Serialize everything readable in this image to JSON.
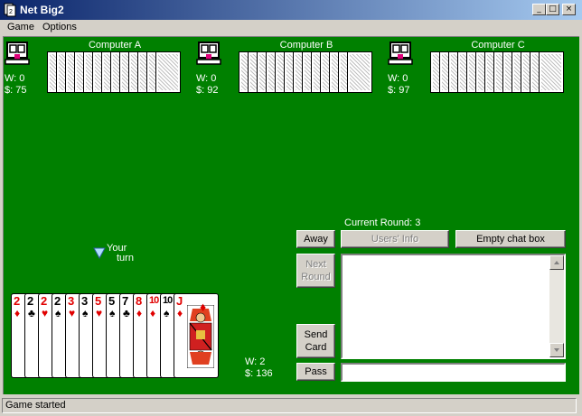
{
  "window": {
    "title": "Net Big2"
  },
  "menu": [
    {
      "label": "Game"
    },
    {
      "label": "Options"
    }
  ],
  "window_buttons": {
    "minimize": "_",
    "maximize": "□",
    "close": "×"
  },
  "opponents": [
    {
      "name": "Computer A",
      "wins": "W: 0",
      "money": "$: 75"
    },
    {
      "name": "Computer B",
      "wins": "W: 0",
      "money": "$: 92"
    },
    {
      "name": "Computer C",
      "wins": "W: 0",
      "money": "$: 97"
    }
  ],
  "turn_indicator": {
    "line1": "Your",
    "line2": "turn"
  },
  "player": {
    "wins": "W: 2",
    "money": "$: 136",
    "cards": [
      {
        "rank": "2",
        "suit": "♦",
        "color": "red"
      },
      {
        "rank": "2",
        "suit": "♣",
        "color": "black"
      },
      {
        "rank": "2",
        "suit": "♥",
        "color": "red"
      },
      {
        "rank": "2",
        "suit": "♠",
        "color": "black"
      },
      {
        "rank": "3",
        "suit": "♥",
        "color": "red"
      },
      {
        "rank": "3",
        "suit": "♠",
        "color": "black"
      },
      {
        "rank": "5",
        "suit": "♥",
        "color": "red"
      },
      {
        "rank": "5",
        "suit": "♠",
        "color": "black"
      },
      {
        "rank": "7",
        "suit": "♣",
        "color": "black"
      },
      {
        "rank": "8",
        "suit": "♦",
        "color": "red"
      },
      {
        "rank": "10",
        "suit": "♦",
        "color": "red"
      },
      {
        "rank": "10",
        "suit": "♠",
        "color": "black"
      },
      {
        "rank": "J",
        "suit": "♦",
        "color": "red"
      }
    ]
  },
  "round": {
    "label": "Current Round: 3"
  },
  "buttons": {
    "away": "Away",
    "users_info": "Users' Info",
    "empty_chat": "Empty chat box",
    "next_round_1": "Next",
    "next_round_2": "Round",
    "send_card_1": "Send",
    "send_card_2": "Card",
    "pass": "Pass"
  },
  "chat": {
    "input_value": ""
  },
  "status": {
    "text": "Game started"
  },
  "colors": {
    "felt": "#008000",
    "titlebar_start": "#0a246a",
    "titlebar_end": "#a6caf0",
    "card_red": "#e00000"
  },
  "icons": {
    "app": "cards-icon",
    "avatar": "computer-avatar-icon",
    "turn": "down-triangle-icon"
  }
}
